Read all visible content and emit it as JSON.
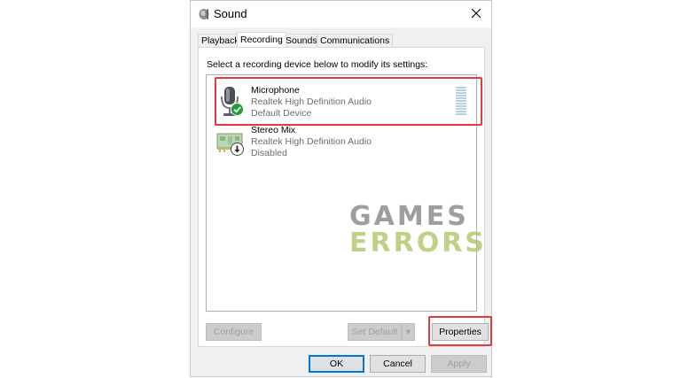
{
  "window": {
    "title": "Sound",
    "close_glyph": "✕"
  },
  "tabs": [
    {
      "label": "Playback",
      "active": false
    },
    {
      "label": "Recording",
      "active": true
    },
    {
      "label": "Sounds",
      "active": false
    },
    {
      "label": "Communications",
      "active": false
    }
  ],
  "recording": {
    "instruction": "Select a recording device below to modify its settings:",
    "devices": [
      {
        "name": "Microphone",
        "driver": "Realtek High Definition Audio",
        "status": "Default Device",
        "icon": "microphone-icon",
        "badge": "default-check-icon",
        "selected": true
      },
      {
        "name": "Stereo Mix",
        "driver": "Realtek High Definition Audio",
        "status": "Disabled",
        "icon": "sound-card-icon",
        "badge": "disabled-arrow-icon",
        "selected": false
      }
    ],
    "level_meter": {
      "level": 0
    }
  },
  "watermark": {
    "line1": "GAMES",
    "line2": "ERRORS"
  },
  "panel_buttons": {
    "configure": "Configure",
    "set_default": "Set Default",
    "dropdown_glyph": "▾",
    "properties": "Properties"
  },
  "dialog_buttons": {
    "ok": "OK",
    "cancel": "Cancel",
    "apply": "Apply"
  },
  "colors": {
    "highlight": "#e23b3b",
    "accent": "#0078d7",
    "watermark_gray": "#6b6b6b",
    "watermark_green": "#a8c45c"
  }
}
